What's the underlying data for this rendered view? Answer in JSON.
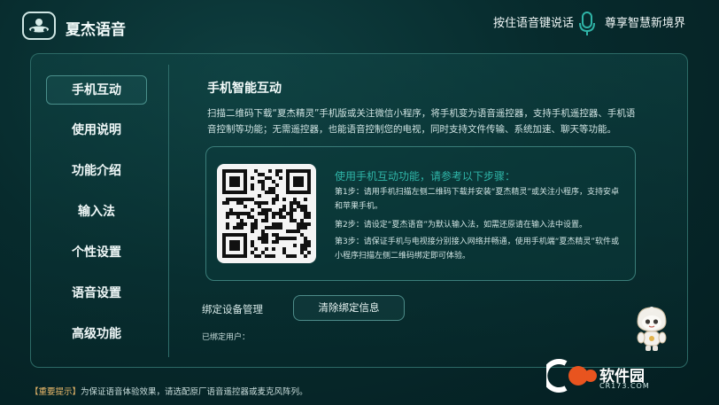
{
  "header": {
    "app_title": "夏杰语音",
    "hint": "按住语音键说话",
    "slogan": "尊享智慧新境界"
  },
  "sidebar": {
    "items": [
      {
        "label": "手机互动",
        "active": true
      },
      {
        "label": "使用说明"
      },
      {
        "label": "功能介绍"
      },
      {
        "label": "输入法"
      },
      {
        "label": "个性设置"
      },
      {
        "label": "语音设置"
      },
      {
        "label": "高级功能"
      }
    ]
  },
  "main": {
    "title": "手机智能互动",
    "description": "扫描二维码下载“夏杰精灵”手机版或关注微信小程序，将手机变为语音遥控器，支持手机遥控器、手机语音控制等功能；无需遥控器，也能语音控制您的电视，同时支持文件传输、系统加速、聊天等功能。",
    "steps_title": "使用手机互动功能，请参考以下步骤：",
    "step1": "第1步：请用手机扫描左侧二维码下载并安装“夏杰精灵”或关注小程序，支持安卓和苹果手机。",
    "step2": "第2步：请设定“夏杰语音”为默认输入法，如需还原请在输入法中设置。",
    "step3": "第3步：请保证手机与电视接分别接入网络并畅通，使用手机端“夏杰精灵”软件或小程序扫描左侧二维码绑定即可体验。",
    "bind_label": "绑定设备管理",
    "clear_button": "清除绑定信息",
    "bound_users": "已绑定用户："
  },
  "footer": {
    "notice_tag": "【重要提示】",
    "notice_text": "为保证语音体验效果，请选配原厂语音遥控器或麦克风阵列。"
  },
  "watermark": {
    "text": "软件园",
    "sub": "CR173.COM"
  },
  "colors": {
    "accent": "#2fb5a8",
    "background": "#072b2d",
    "notice_tag": "#e9b86a"
  }
}
